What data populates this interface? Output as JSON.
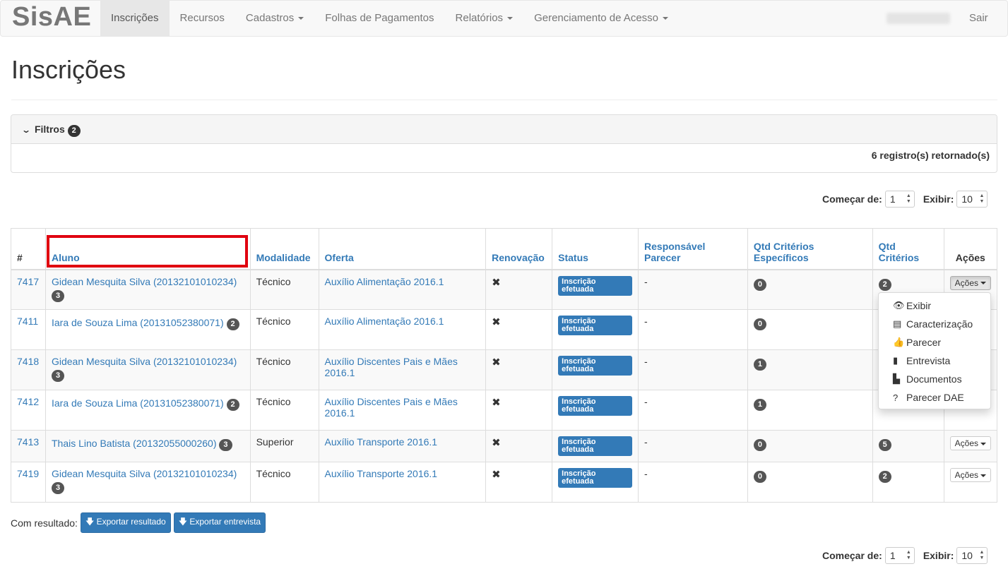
{
  "nav": {
    "brand": "SisAE",
    "items": [
      {
        "label": "Inscrições",
        "active": true,
        "dropdown": false
      },
      {
        "label": "Recursos",
        "active": false,
        "dropdown": false
      },
      {
        "label": "Cadastros",
        "active": false,
        "dropdown": true
      },
      {
        "label": "Folhas de Pagamentos",
        "active": false,
        "dropdown": false
      },
      {
        "label": "Relatórios",
        "active": false,
        "dropdown": true
      },
      {
        "label": "Gerenciamento de Acesso",
        "active": false,
        "dropdown": true
      }
    ],
    "logout": "Sair"
  },
  "page": {
    "title": "Inscrições"
  },
  "filters": {
    "label": "Filtros",
    "count": "2",
    "result_text": "6 registro(s) retornado(s)"
  },
  "pager": {
    "start_label": "Começar de:",
    "start_value": "1",
    "show_label": "Exibir:",
    "show_value": "10"
  },
  "table": {
    "headers": {
      "num": "#",
      "aluno": "Aluno",
      "modalidade": "Modalidade",
      "oferta": "Oferta",
      "renovacao": "Renovação",
      "status": "Status",
      "responsavel": "Responsável Parecer",
      "qtd_especificos": "Qtd Critérios Específicos",
      "qtd_criterios": "Qtd Critérios",
      "acoes": "Ações"
    },
    "rows": [
      {
        "id": "7417",
        "aluno": "Gidean Mesquita Silva (20132101010234)",
        "aluno_badge": "3",
        "modalidade": "Técnico",
        "oferta": "Auxílio Alimentação 2016.1",
        "renovacao": "✖",
        "status": "Inscrição efetuada",
        "responsavel": "-",
        "qtd_especificos": "0",
        "qtd_criterios": "2",
        "acoes": "Ações"
      },
      {
        "id": "7411",
        "aluno": "Iara de Souza Lima (20131052380071)",
        "aluno_badge": "2",
        "modalidade": "Técnico",
        "oferta": "Auxílio Alimentação 2016.1",
        "renovacao": "✖",
        "status": "Inscrição efetuada",
        "responsavel": "-",
        "qtd_especificos": "0",
        "qtd_criterios": "",
        "acoes": ""
      },
      {
        "id": "7418",
        "aluno": "Gidean Mesquita Silva (20132101010234)",
        "aluno_badge": "3",
        "modalidade": "Técnico",
        "oferta": "Auxílio Discentes Pais e Mães 2016.1",
        "renovacao": "✖",
        "status": "Inscrição efetuada",
        "responsavel": "-",
        "qtd_especificos": "1",
        "qtd_criterios": "",
        "acoes": ""
      },
      {
        "id": "7412",
        "aluno": "Iara de Souza Lima (20131052380071)",
        "aluno_badge": "2",
        "modalidade": "Técnico",
        "oferta": "Auxílio Discentes Pais e Mães 2016.1",
        "renovacao": "✖",
        "status": "Inscrição efetuada",
        "responsavel": "-",
        "qtd_especificos": "1",
        "qtd_criterios": "",
        "acoes": ""
      },
      {
        "id": "7413",
        "aluno": "Thais Lino Batista (20132055000260)",
        "aluno_badge": "3",
        "modalidade": "Superior",
        "oferta": "Auxílio Transporte 2016.1",
        "renovacao": "✖",
        "status": "Inscrição efetuada",
        "responsavel": "-",
        "qtd_especificos": "0",
        "qtd_criterios": "5",
        "acoes": "Ações"
      },
      {
        "id": "7419",
        "aluno": "Gidean Mesquita Silva (20132101010234)",
        "aluno_badge": "3",
        "modalidade": "Técnico",
        "oferta": "Auxílio Transporte 2016.1",
        "renovacao": "✖",
        "status": "Inscrição efetuada",
        "responsavel": "-",
        "qtd_especificos": "0",
        "qtd_criterios": "2",
        "acoes": "Ações"
      }
    ]
  },
  "dropdown": {
    "items": [
      {
        "label": "Exibir",
        "icon": "eye-icon",
        "glyph": "👁"
      },
      {
        "label": "Caracterização",
        "icon": "list-icon",
        "glyph": "▤"
      },
      {
        "label": "Parecer",
        "icon": "thumbs-icon",
        "glyph": "👍"
      },
      {
        "label": "Entrevista",
        "icon": "book-icon",
        "glyph": "▮"
      },
      {
        "label": "Documentos",
        "icon": "file-icon",
        "glyph": "▙"
      },
      {
        "label": "Parecer DAE",
        "icon": "question-icon",
        "glyph": "?"
      }
    ]
  },
  "export": {
    "label": "Com resultado:",
    "btn_resultado": "Exportar resultado",
    "btn_entrevista": "Exportar entrevista",
    "arrow": "🡇"
  },
  "colors": {
    "link": "#337ab7",
    "highlight": "#e0000f",
    "badge": "#555555"
  }
}
